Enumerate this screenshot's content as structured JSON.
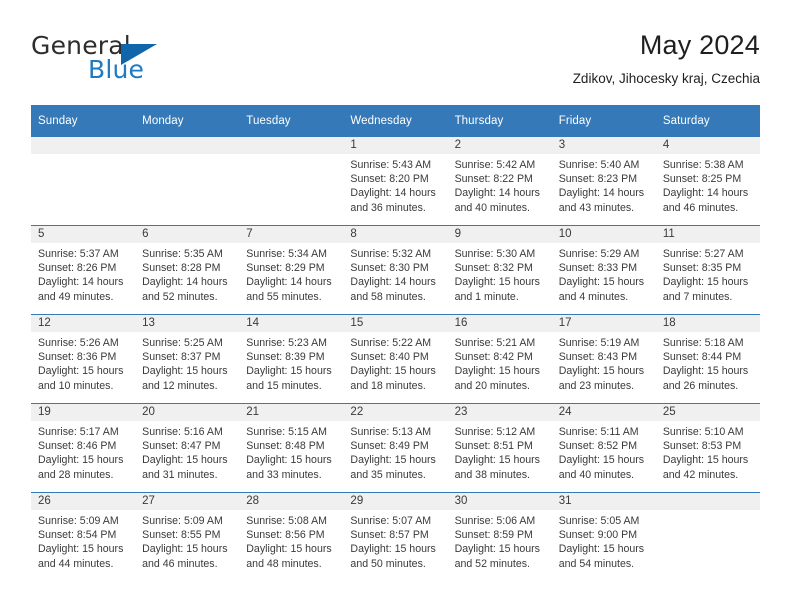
{
  "brand": {
    "name_top": "General",
    "name_bottom": "Blue",
    "accent_color": "#1166ab",
    "text_color": "#1f7ac4"
  },
  "header": {
    "title": "May 2024",
    "subtitle": "Zdikov, Jihocesky kraj, Czechia"
  },
  "theme": {
    "header_bar": "#3679b8",
    "daynum_band": "#f0f0f0",
    "row_divider": "#3679b8",
    "text": "#3a3a3a"
  },
  "weekdays": [
    "Sunday",
    "Monday",
    "Tuesday",
    "Wednesday",
    "Thursday",
    "Friday",
    "Saturday"
  ],
  "labels": {
    "sunrise_prefix": "Sunrise:",
    "sunset_prefix": "Sunset:",
    "daylight_prefix": "Daylight:"
  },
  "weeks": [
    [
      {
        "day": "",
        "sunrise": "",
        "sunset": "",
        "daylight_line1": "",
        "daylight_line2": ""
      },
      {
        "day": "",
        "sunrise": "",
        "sunset": "",
        "daylight_line1": "",
        "daylight_line2": ""
      },
      {
        "day": "",
        "sunrise": "",
        "sunset": "",
        "daylight_line1": "",
        "daylight_line2": ""
      },
      {
        "day": "1",
        "sunrise": "Sunrise: 5:43 AM",
        "sunset": "Sunset: 8:20 PM",
        "daylight_line1": "Daylight: 14 hours",
        "daylight_line2": "and 36 minutes."
      },
      {
        "day": "2",
        "sunrise": "Sunrise: 5:42 AM",
        "sunset": "Sunset: 8:22 PM",
        "daylight_line1": "Daylight: 14 hours",
        "daylight_line2": "and 40 minutes."
      },
      {
        "day": "3",
        "sunrise": "Sunrise: 5:40 AM",
        "sunset": "Sunset: 8:23 PM",
        "daylight_line1": "Daylight: 14 hours",
        "daylight_line2": "and 43 minutes."
      },
      {
        "day": "4",
        "sunrise": "Sunrise: 5:38 AM",
        "sunset": "Sunset: 8:25 PM",
        "daylight_line1": "Daylight: 14 hours",
        "daylight_line2": "and 46 minutes."
      }
    ],
    [
      {
        "day": "5",
        "sunrise": "Sunrise: 5:37 AM",
        "sunset": "Sunset: 8:26 PM",
        "daylight_line1": "Daylight: 14 hours",
        "daylight_line2": "and 49 minutes."
      },
      {
        "day": "6",
        "sunrise": "Sunrise: 5:35 AM",
        "sunset": "Sunset: 8:28 PM",
        "daylight_line1": "Daylight: 14 hours",
        "daylight_line2": "and 52 minutes."
      },
      {
        "day": "7",
        "sunrise": "Sunrise: 5:34 AM",
        "sunset": "Sunset: 8:29 PM",
        "daylight_line1": "Daylight: 14 hours",
        "daylight_line2": "and 55 minutes."
      },
      {
        "day": "8",
        "sunrise": "Sunrise: 5:32 AM",
        "sunset": "Sunset: 8:30 PM",
        "daylight_line1": "Daylight: 14 hours",
        "daylight_line2": "and 58 minutes."
      },
      {
        "day": "9",
        "sunrise": "Sunrise: 5:30 AM",
        "sunset": "Sunset: 8:32 PM",
        "daylight_line1": "Daylight: 15 hours",
        "daylight_line2": "and 1 minute."
      },
      {
        "day": "10",
        "sunrise": "Sunrise: 5:29 AM",
        "sunset": "Sunset: 8:33 PM",
        "daylight_line1": "Daylight: 15 hours",
        "daylight_line2": "and 4 minutes."
      },
      {
        "day": "11",
        "sunrise": "Sunrise: 5:27 AM",
        "sunset": "Sunset: 8:35 PM",
        "daylight_line1": "Daylight: 15 hours",
        "daylight_line2": "and 7 minutes."
      }
    ],
    [
      {
        "day": "12",
        "sunrise": "Sunrise: 5:26 AM",
        "sunset": "Sunset: 8:36 PM",
        "daylight_line1": "Daylight: 15 hours",
        "daylight_line2": "and 10 minutes."
      },
      {
        "day": "13",
        "sunrise": "Sunrise: 5:25 AM",
        "sunset": "Sunset: 8:37 PM",
        "daylight_line1": "Daylight: 15 hours",
        "daylight_line2": "and 12 minutes."
      },
      {
        "day": "14",
        "sunrise": "Sunrise: 5:23 AM",
        "sunset": "Sunset: 8:39 PM",
        "daylight_line1": "Daylight: 15 hours",
        "daylight_line2": "and 15 minutes."
      },
      {
        "day": "15",
        "sunrise": "Sunrise: 5:22 AM",
        "sunset": "Sunset: 8:40 PM",
        "daylight_line1": "Daylight: 15 hours",
        "daylight_line2": "and 18 minutes."
      },
      {
        "day": "16",
        "sunrise": "Sunrise: 5:21 AM",
        "sunset": "Sunset: 8:42 PM",
        "daylight_line1": "Daylight: 15 hours",
        "daylight_line2": "and 20 minutes."
      },
      {
        "day": "17",
        "sunrise": "Sunrise: 5:19 AM",
        "sunset": "Sunset: 8:43 PM",
        "daylight_line1": "Daylight: 15 hours",
        "daylight_line2": "and 23 minutes."
      },
      {
        "day": "18",
        "sunrise": "Sunrise: 5:18 AM",
        "sunset": "Sunset: 8:44 PM",
        "daylight_line1": "Daylight: 15 hours",
        "daylight_line2": "and 26 minutes."
      }
    ],
    [
      {
        "day": "19",
        "sunrise": "Sunrise: 5:17 AM",
        "sunset": "Sunset: 8:46 PM",
        "daylight_line1": "Daylight: 15 hours",
        "daylight_line2": "and 28 minutes."
      },
      {
        "day": "20",
        "sunrise": "Sunrise: 5:16 AM",
        "sunset": "Sunset: 8:47 PM",
        "daylight_line1": "Daylight: 15 hours",
        "daylight_line2": "and 31 minutes."
      },
      {
        "day": "21",
        "sunrise": "Sunrise: 5:15 AM",
        "sunset": "Sunset: 8:48 PM",
        "daylight_line1": "Daylight: 15 hours",
        "daylight_line2": "and 33 minutes."
      },
      {
        "day": "22",
        "sunrise": "Sunrise: 5:13 AM",
        "sunset": "Sunset: 8:49 PM",
        "daylight_line1": "Daylight: 15 hours",
        "daylight_line2": "and 35 minutes."
      },
      {
        "day": "23",
        "sunrise": "Sunrise: 5:12 AM",
        "sunset": "Sunset: 8:51 PM",
        "daylight_line1": "Daylight: 15 hours",
        "daylight_line2": "and 38 minutes."
      },
      {
        "day": "24",
        "sunrise": "Sunrise: 5:11 AM",
        "sunset": "Sunset: 8:52 PM",
        "daylight_line1": "Daylight: 15 hours",
        "daylight_line2": "and 40 minutes."
      },
      {
        "day": "25",
        "sunrise": "Sunrise: 5:10 AM",
        "sunset": "Sunset: 8:53 PM",
        "daylight_line1": "Daylight: 15 hours",
        "daylight_line2": "and 42 minutes."
      }
    ],
    [
      {
        "day": "26",
        "sunrise": "Sunrise: 5:09 AM",
        "sunset": "Sunset: 8:54 PM",
        "daylight_line1": "Daylight: 15 hours",
        "daylight_line2": "and 44 minutes."
      },
      {
        "day": "27",
        "sunrise": "Sunrise: 5:09 AM",
        "sunset": "Sunset: 8:55 PM",
        "daylight_line1": "Daylight: 15 hours",
        "daylight_line2": "and 46 minutes."
      },
      {
        "day": "28",
        "sunrise": "Sunrise: 5:08 AM",
        "sunset": "Sunset: 8:56 PM",
        "daylight_line1": "Daylight: 15 hours",
        "daylight_line2": "and 48 minutes."
      },
      {
        "day": "29",
        "sunrise": "Sunrise: 5:07 AM",
        "sunset": "Sunset: 8:57 PM",
        "daylight_line1": "Daylight: 15 hours",
        "daylight_line2": "and 50 minutes."
      },
      {
        "day": "30",
        "sunrise": "Sunrise: 5:06 AM",
        "sunset": "Sunset: 8:59 PM",
        "daylight_line1": "Daylight: 15 hours",
        "daylight_line2": "and 52 minutes."
      },
      {
        "day": "31",
        "sunrise": "Sunrise: 5:05 AM",
        "sunset": "Sunset: 9:00 PM",
        "daylight_line1": "Daylight: 15 hours",
        "daylight_line2": "and 54 minutes."
      },
      {
        "day": "",
        "sunrise": "",
        "sunset": "",
        "daylight_line1": "",
        "daylight_line2": ""
      }
    ]
  ]
}
